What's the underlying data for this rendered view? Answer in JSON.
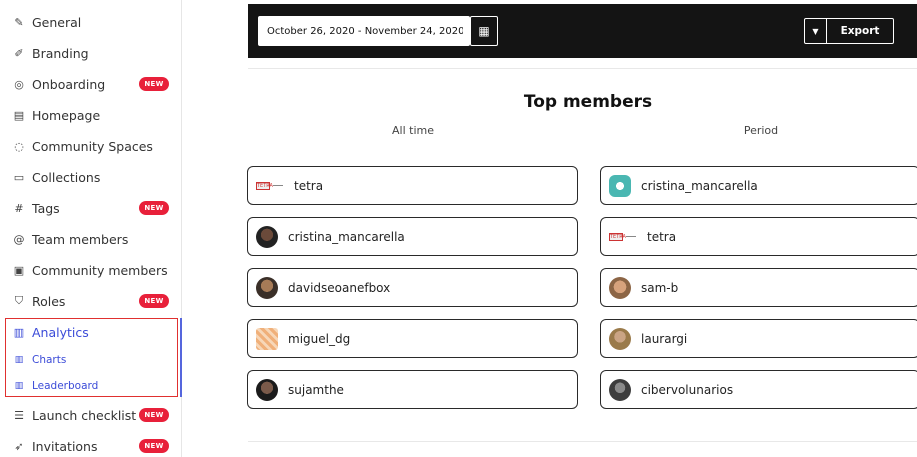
{
  "sidebar": {
    "items": [
      {
        "label": "General",
        "icon": "edit-icon"
      },
      {
        "label": "Branding",
        "icon": "brush-icon"
      },
      {
        "label": "Onboarding",
        "icon": "compass-icon",
        "badge": "NEW"
      },
      {
        "label": "Homepage",
        "icon": "layout-icon"
      },
      {
        "label": "Community Spaces",
        "icon": "chat-icon"
      },
      {
        "label": "Collections",
        "icon": "folder-icon"
      },
      {
        "label": "Tags",
        "icon": "hash-icon",
        "badge": "NEW"
      },
      {
        "label": "Team members",
        "icon": "at-icon"
      },
      {
        "label": "Community members",
        "icon": "id-card-icon"
      },
      {
        "label": "Roles",
        "icon": "shield-icon",
        "badge": "NEW"
      },
      {
        "label": "Analytics",
        "icon": "bar-chart-icon"
      },
      {
        "label": "Charts",
        "icon": "bar-chart-icon"
      },
      {
        "label": "Leaderboard",
        "icon": "bar-chart-icon"
      },
      {
        "label": "Launch checklist",
        "icon": "checklist-icon",
        "badge": "NEW"
      },
      {
        "label": "Invitations",
        "icon": "send-icon",
        "badge": "NEW"
      }
    ]
  },
  "toolbar": {
    "date_range": "October 26, 2020 - November 24, 2020",
    "export_label": "Export"
  },
  "main": {
    "title": "Top members",
    "all_time_label": "All time",
    "period_label": "Period",
    "all_time": [
      "tetra",
      "cristina_mancarella",
      "davidseoanefbox",
      "miguel_dg",
      "sujamthe"
    ],
    "period": [
      "cristina_mancarella",
      "tetra",
      "sam-b",
      "laurargi",
      "cibervolunarios"
    ]
  },
  "colors": {
    "accent": "#3b4bd8",
    "badge": "#e8203a",
    "topbar": "#141414",
    "highlight_box": "#e0302f"
  }
}
